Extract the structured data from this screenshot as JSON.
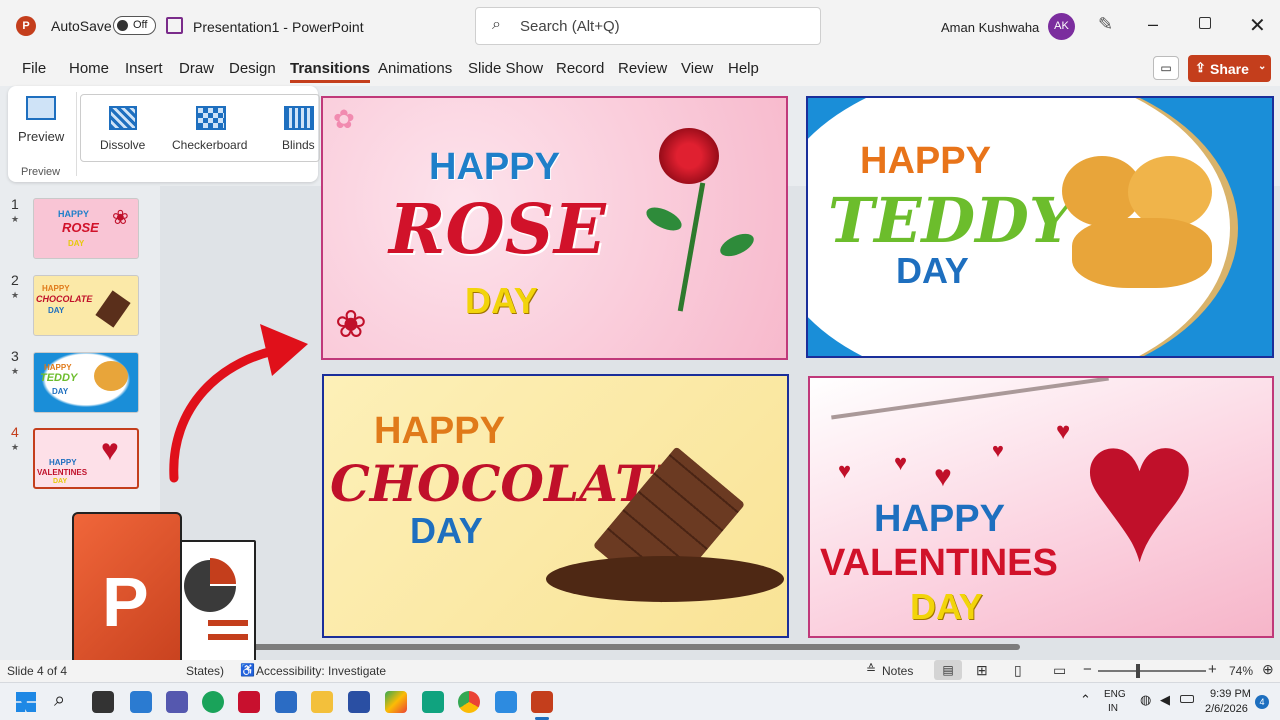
{
  "app": {
    "autosave_label": "AutoSave",
    "autosave_state": "Off",
    "doc_title": "Presentation1 -",
    "app_name": "PowerPoint",
    "search_placeholder": "Search (Alt+Q)",
    "user_name": "Aman Kushwaha",
    "user_initials": "AK"
  },
  "tabs": [
    "File",
    "Home",
    "Insert",
    "Draw",
    "Design",
    "Transitions",
    "Animations",
    "Slide Show",
    "Record",
    "Review",
    "View",
    "Help"
  ],
  "share_label": "Share",
  "ribbon": {
    "preview_label": "Preview",
    "group_label": "Preview",
    "effects": [
      "Dissolve",
      "Checkerboard",
      "Blinds"
    ]
  },
  "thumbnails": [
    {
      "num": "1",
      "l1": "HAPPY",
      "l2": "ROSE",
      "l3": "DAY"
    },
    {
      "num": "2",
      "l1": "HAPPY",
      "l2": "CHOCOLATE",
      "l3": "DAY"
    },
    {
      "num": "3",
      "l1": "HAPPY",
      "l2": "TEDDY",
      "l3": "DAY"
    },
    {
      "num": "4",
      "l1": "HAPPY",
      "l2": "VALENTINES",
      "l3": "DAY"
    }
  ],
  "slides": {
    "rose": {
      "l1": "HAPPY",
      "l2": "ROSE",
      "l3": "DAY"
    },
    "teddy": {
      "l1": "HAPPY",
      "l2": "TEDDY",
      "l3": "DAY"
    },
    "chocolate": {
      "l1": "HAPPY",
      "l2": "CHOCOLATE",
      "l3": "DAY"
    },
    "valentines": {
      "l1": "HAPPY",
      "l2": "VALENTINES",
      "l3": "DAY"
    }
  },
  "status": {
    "slide_info": "Slide 4 of 4",
    "states": "States)",
    "accessibility": "Accessibility: Investigate",
    "notes": "Notes",
    "zoom": "74%"
  },
  "taskbar": {
    "lang1": "ENG",
    "lang2": "IN",
    "time": "9:39 PM",
    "date": "2/6/2026",
    "badge": "4"
  },
  "colors": {
    "accent": "#c43e1c",
    "rose_bg": "#f9c5d5",
    "teddy_bg": "#1a8ed8",
    "choc_bg": "#fbe9a8",
    "val_bg": "#fde0e8"
  }
}
